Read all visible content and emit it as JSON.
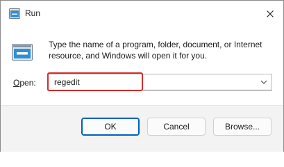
{
  "window": {
    "title": "Run"
  },
  "content": {
    "description": "Type the name of a program, folder, document, or Internet resource, and Windows will open it for you.",
    "open_label_mnemonic": "O",
    "open_label_rest": "pen:",
    "open_value": "regedit"
  },
  "footer": {
    "ok_label": "OK",
    "cancel_label": "Cancel",
    "browse_label": "Browse..."
  },
  "colors": {
    "accent": "#005fb8",
    "highlight": "#d72a2a",
    "footer_bg": "#f3f3f3"
  },
  "icons": [
    "run-app-icon",
    "close-icon",
    "run-large-icon",
    "chevron-down-icon"
  ]
}
